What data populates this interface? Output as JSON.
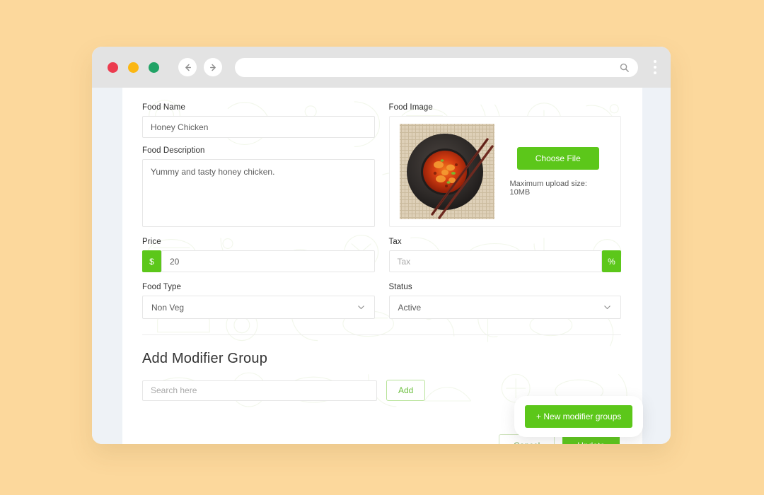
{
  "theme": {
    "page_background": "#fcd89c",
    "accent_green": "#5cc71a",
    "chrome_grey": "#e3e3e3",
    "rail_blue_grey": "#eef2f6"
  },
  "browser": {
    "traffic_lights": [
      {
        "name": "close",
        "color": "#ec3b4f"
      },
      {
        "name": "minimize",
        "color": "#fbb713"
      },
      {
        "name": "maximize",
        "color": "#21a366"
      }
    ],
    "back_icon": "arrow-left-icon",
    "forward_icon": "arrow-right-icon",
    "address_value": "",
    "address_placeholder": "",
    "search_icon": "search-icon",
    "menu_icon": "kebab-menu-icon"
  },
  "form": {
    "food_name": {
      "label": "Food Name",
      "value": "Honey Chicken",
      "placeholder": "Food Name"
    },
    "food_description": {
      "label": "Food Description",
      "value": "Yummy and tasty honey chicken.",
      "placeholder": "Food Description"
    },
    "food_image": {
      "label": "Food Image",
      "choose_file_label": "Choose File",
      "upload_note": "Maximum upload size: 10MB",
      "thumbnail_alt": "spicy-stew-in-stone-bowl"
    },
    "price": {
      "label": "Price",
      "prefix_symbol": "$",
      "value": "20",
      "placeholder": "Price"
    },
    "tax": {
      "label": "Tax",
      "suffix_symbol": "%",
      "value": "",
      "placeholder": "Tax"
    },
    "food_type": {
      "label": "Food Type",
      "selected": "Non Veg",
      "chevron_icon": "chevron-down-icon"
    },
    "status": {
      "label": "Status",
      "selected": "Active",
      "chevron_icon": "chevron-down-icon"
    }
  },
  "modifier_group": {
    "title": "Add Modifier Group",
    "search_value": "",
    "search_placeholder": "Search here",
    "add_label": "Add"
  },
  "popover": {
    "new_modifier_groups_label": "+ New modifier groups"
  },
  "footer": {
    "cancel_label": "Cancel",
    "update_label": "Update"
  }
}
